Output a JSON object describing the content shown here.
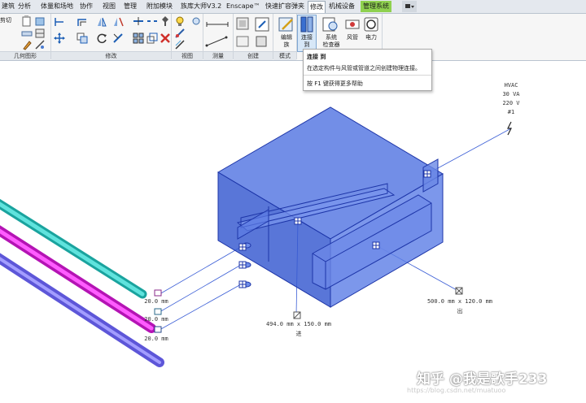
{
  "tabs": [
    {
      "label": "建筑"
    },
    {
      "label": "分析"
    },
    {
      "label": "体量和场地"
    },
    {
      "label": "协作"
    },
    {
      "label": "视图"
    },
    {
      "label": "管理"
    },
    {
      "label": "附加模块"
    },
    {
      "label": "族库大师V3.2"
    },
    {
      "label": "Enscape™"
    },
    {
      "label": "快速扩容弹夹"
    },
    {
      "label": "修改"
    },
    {
      "label": "机械设备"
    },
    {
      "label": "管理系统"
    }
  ],
  "ribbon": {
    "cut_label": "剪切",
    "panels": [
      "几何图形",
      "修改",
      "视图",
      "测量",
      "创建",
      "模式"
    ],
    "buttons": {
      "edit_family": "编辑\n族",
      "connect_to": "连接\n到",
      "system_inspector": "系统\n检查器",
      "duct": "风管",
      "power": "电力"
    }
  },
  "tooltip": {
    "title": "连接 到",
    "description": "在选定构件与风管或管道之间创建物理连接。",
    "help": "按 F1 键获得更多帮助"
  },
  "annotations": {
    "electrical": [
      "HVAC",
      "30 VA",
      "220 V",
      "#1"
    ],
    "pipe_dims": [
      "20.0 mm",
      "20.0 mm",
      "20.0 mm"
    ],
    "inlet_size": "494.0 mm x 150.0 mm",
    "inlet_label": "进",
    "outlet_size": "500.0 mm x 120.0 mm",
    "outlet_label": "出"
  },
  "watermark": {
    "text": "知乎 @我是歌手233",
    "url": "https://blog.csdn.net/muatuoo"
  },
  "colors": {
    "equipment_fill": "#3c5fd6",
    "equipment_edge": "#1d35a8",
    "pipe_cyan": "#22c3bd",
    "pipe_magenta": "#e61fe6",
    "pipe_purple": "#7a73e8",
    "accent_tab": "#8fd14f"
  }
}
